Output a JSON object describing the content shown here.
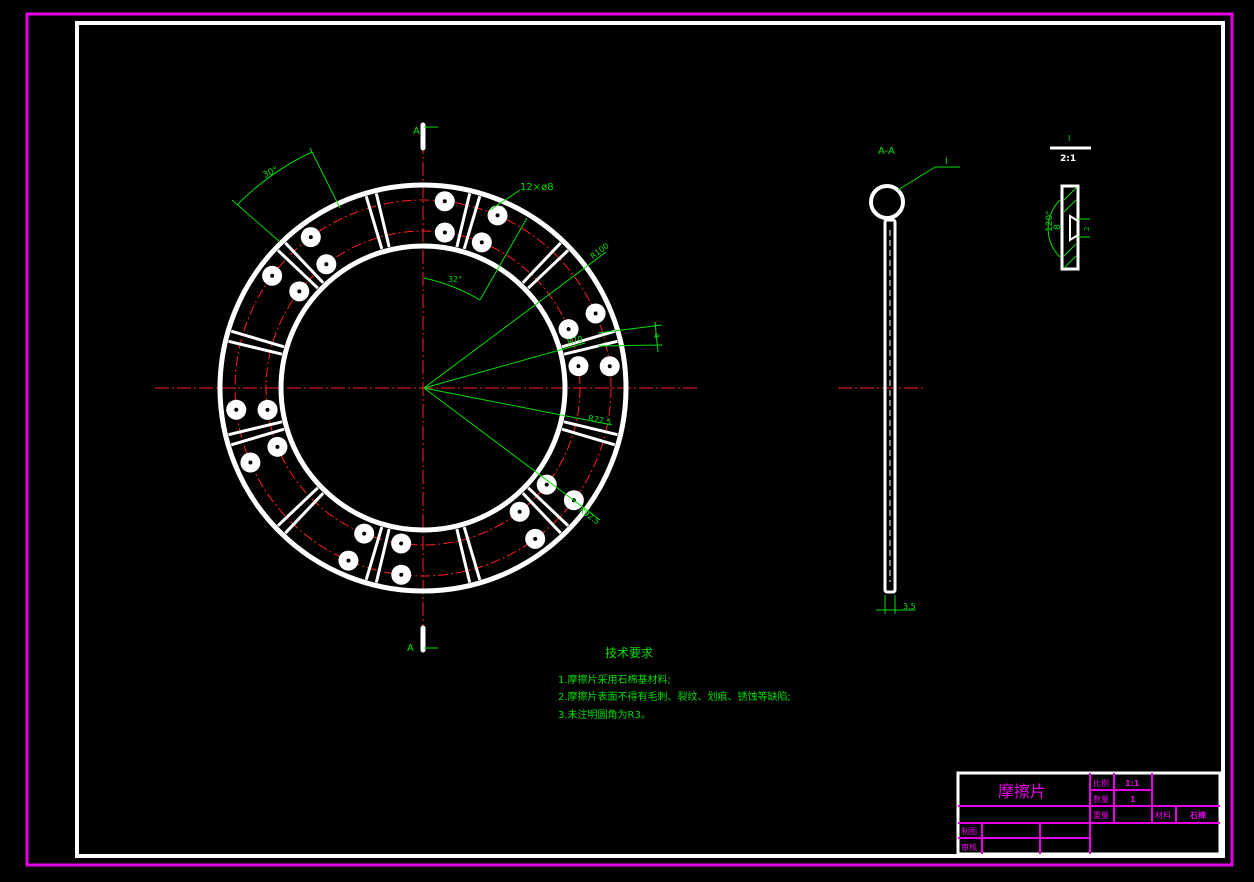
{
  "colors": {
    "background": "#000000",
    "outer_border": "#e600e6",
    "frame": "#ffffff",
    "dimension": "#00dd00",
    "centerline": "#ff2020",
    "title_text": "#e600e6"
  },
  "front_view": {
    "section_label_top": "A",
    "section_label_bottom": "A",
    "angle_segment": "30°",
    "angle_offset": "32°",
    "holes_note": "12×ø8",
    "radius_outer": "R100",
    "radius_inner": "R70",
    "radius_hole_circle_inner": "R77.5",
    "radius_hole_circle_outer": "R92.5",
    "groove_width": "4"
  },
  "section_view": {
    "title": "A-A",
    "detail_marker": "I",
    "thickness": "3.5"
  },
  "detail_view": {
    "title": "I",
    "scale": "2:1",
    "countersink_angle": "120°",
    "hole_diameter": "8",
    "depth": "2"
  },
  "notes": {
    "heading": "技术要求",
    "items": [
      "1.摩擦片采用石棉基材料;",
      "2.摩擦片表面不得有毛刺、裂纹、划痕、锈蚀等缺陷;",
      "3.未注明圆角为R3。"
    ]
  },
  "title_block": {
    "part_name": "摩擦片",
    "scale_label": "比例",
    "scale_value": "1:1",
    "qty_label": "数量",
    "qty_value": "1",
    "weight_label": "重量",
    "material_label": "材料",
    "material_value": "石棉",
    "drawn_label": "制图",
    "checked_label": "审核"
  }
}
